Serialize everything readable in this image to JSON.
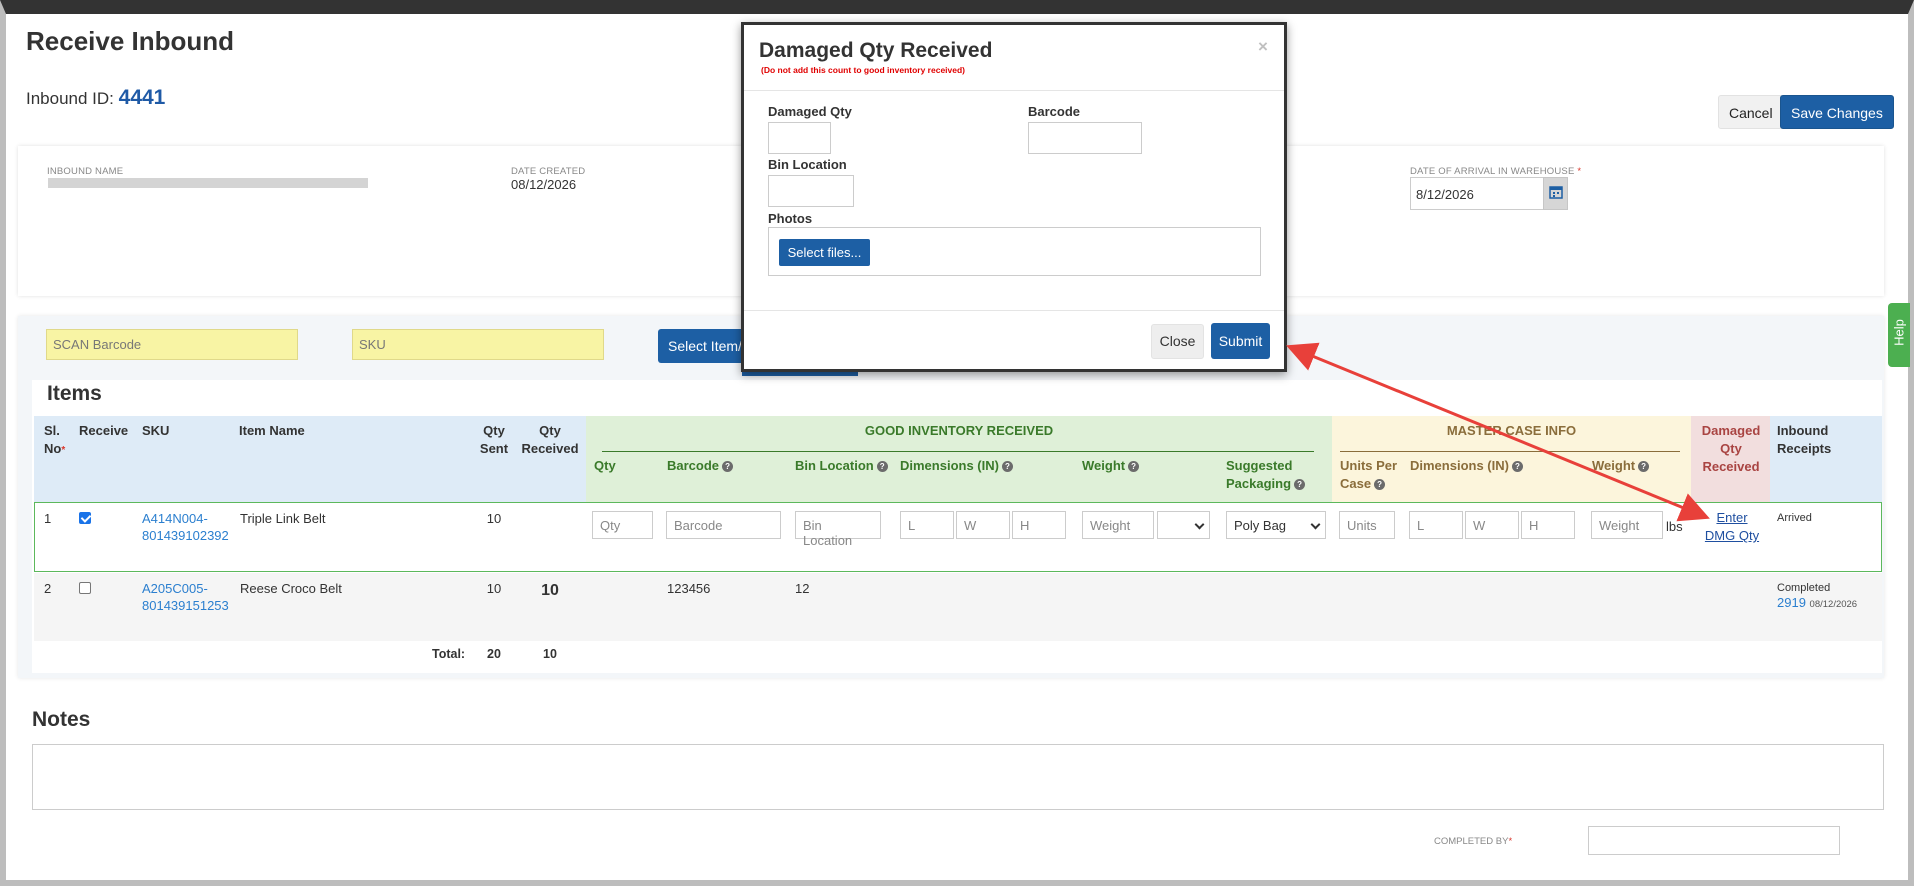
{
  "page": {
    "title": "Receive Inbound",
    "inbound_id_label": "Inbound ID:",
    "inbound_id": "4441",
    "cancel_label": "Cancel",
    "save_label": "Save Changes"
  },
  "details": {
    "inbound_name_label": "INBOUND NAME",
    "date_created_label": "DATE CREATED",
    "date_created": "08/12/2026",
    "arrival_label": "DATE OF ARRIVAL IN WAREHOUSE",
    "arrival_required": "*",
    "arrival_value": "8/12/2026"
  },
  "toolbar": {
    "scan_placeholder": "SCAN Barcode",
    "sku_placeholder": "SKU",
    "select_item_label": "Select Item/F"
  },
  "items": {
    "title": "Items",
    "headers": {
      "sl_no": "Sl. No",
      "required": "*",
      "receive": "Receive",
      "sku": "SKU",
      "item_name": "Item Name",
      "qty_sent": "Qty Sent",
      "qty_received": "Qty Received",
      "good_inventory": "GOOD INVENTORY RECEIVED",
      "qty": "Qty",
      "barcode": "Barcode",
      "bin_location": "Bin Location",
      "dimensions": "Dimensions (IN)",
      "weight": "Weight",
      "suggested_packaging": "Suggested Packaging",
      "master_case": "MASTER CASE INFO",
      "units_per_case": "Units Per Case",
      "mc_dimensions": "Dimensions (IN)",
      "mc_weight": "Weight",
      "damaged": "Damaged Qty Received",
      "inbound_receipts": "Inbound Receipts"
    },
    "rows": [
      {
        "sl": "1",
        "checked": true,
        "sku_line1": "A414N004-",
        "sku_line2": "801439102392",
        "name": "Triple Link Belt",
        "qty_sent": "10",
        "qty_received": "",
        "ph_qty": "Qty",
        "ph_barcode": "Barcode",
        "ph_bin": "Bin Location",
        "ph_l": "L",
        "ph_w": "W",
        "ph_h": "H",
        "ph_weight": "Weight",
        "packaging": "Poly Bag",
        "ph_units": "Units",
        "ph_mc_weight": "Weight",
        "lbs": "lbs",
        "dmg_line1": "Enter",
        "dmg_line2": "DMG Qty",
        "receipt_status": "Arrived"
      },
      {
        "sl": "2",
        "checked": false,
        "sku_line1": "A205C005-",
        "sku_line2": "801439151253",
        "name": "Reese Croco Belt",
        "qty_sent": "10",
        "qty_received": "10",
        "barcode": "123456",
        "bin": "12",
        "receipt_status": "Completed",
        "receipt_id": "2919",
        "receipt_date": "08/12/2026"
      }
    ],
    "total_label": "Total:",
    "total_sent": "20",
    "total_received": "10"
  },
  "notes": {
    "title": "Notes",
    "completed_by_label": "COMPLETED BY",
    "required": "*"
  },
  "help": {
    "label": "Help"
  },
  "modal": {
    "title": "Damaged Qty Received",
    "subtitle": "(Do not add this count to good inventory received)",
    "close_x": "×",
    "damaged_qty_label": "Damaged Qty",
    "barcode_label": "Barcode",
    "bin_location_label": "Bin Location",
    "photos_label": "Photos",
    "select_files_label": "Select files...",
    "close_label": "Close",
    "submit_label": "Submit"
  },
  "colors": {
    "primary": "#1d5fa4",
    "link": "#2b7fcf",
    "good_header": "#dff0d8",
    "master_header": "#fcf5dc",
    "damaged_header": "#f2dede",
    "annotation_arrow": "#e8403a",
    "scan_field": "#f8f4a4"
  }
}
